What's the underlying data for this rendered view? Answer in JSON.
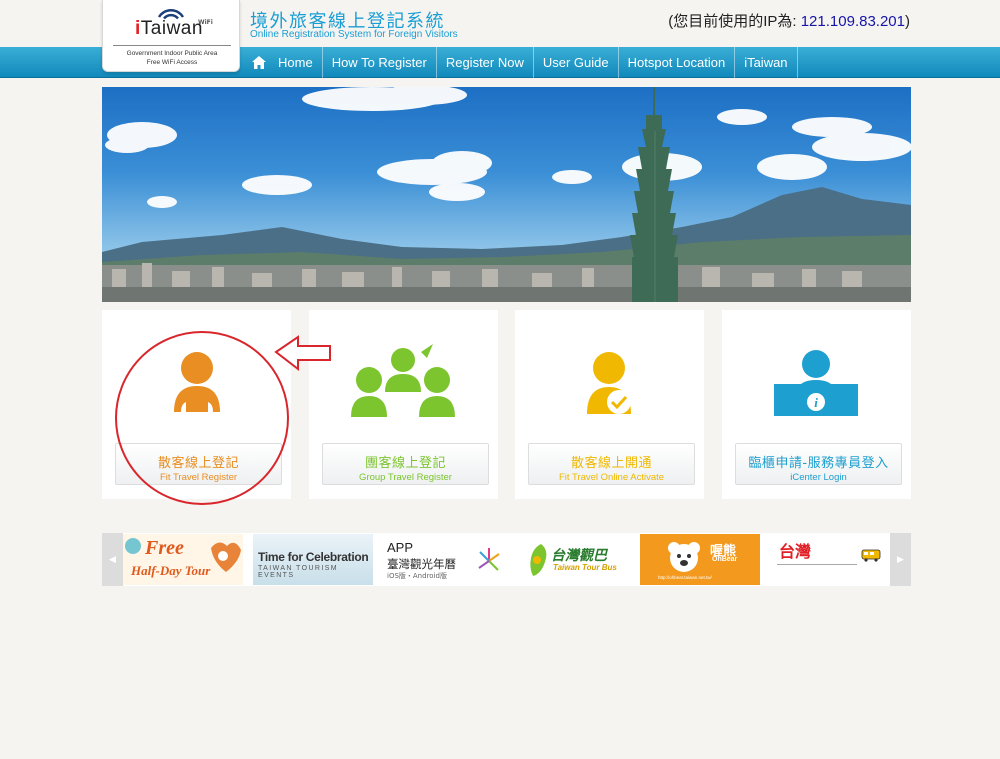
{
  "logo": {
    "brand_prefix": "i",
    "brand_rest": "Taiwan",
    "wifi_label": "WiFi",
    "sub_line1": "Government Indoor Public Area",
    "sub_line2": "Free WiFi Access"
  },
  "header": {
    "title_zh": "境外旅客線上登記系統",
    "title_en": "Online Registration System for Foreign Visitors",
    "ip_prefix": "(您目前使用的IP為: ",
    "ip_value": "121.109.83.201",
    "ip_suffix": ")"
  },
  "nav": {
    "home_icon": "home-icon",
    "items": [
      "Home",
      "How To Register",
      "Register Now",
      "User Guide",
      "Hotspot Location",
      "iTaiwan"
    ]
  },
  "cards": [
    {
      "label_zh": "散客線上登記",
      "label_en": "Fit Travel Register",
      "color": "#e98e22",
      "icon": "single-person-icon"
    },
    {
      "label_zh": "團客線上登記",
      "label_en": "Group Travel Register",
      "color": "#7cc52f",
      "icon": "group-icon"
    },
    {
      "label_zh": "散客線上開通",
      "label_en": "Fit Travel Online Activate",
      "color": "#f0b800",
      "icon": "person-check-icon"
    },
    {
      "label_zh": "臨櫃申請-服務專員登入",
      "label_en": "iCenter  Login",
      "color": "#1d9fd0",
      "icon": "info-counter-icon"
    }
  ],
  "partners": [
    {
      "line1": "Free",
      "line2": "Half-Day Tour"
    },
    {
      "line1": "Time for Celebration",
      "line2": "TAIWAN TOURISM EVENTS"
    },
    {
      "line1": "APP",
      "line2": "臺灣觀光年曆",
      "line3": "iOS版・Android版"
    },
    {
      "line1": "台灣觀巴",
      "line2": "Taiwan Tour Bus"
    },
    {
      "line1": "喔熊",
      "line2": "OhBear",
      "line3": "http://ohbear.taiwan.net.tw/"
    },
    {
      "line1": "台灣"
    }
  ],
  "colors": {
    "accent_blue": "#1a9ed4",
    "nav_blue": "#1189bb",
    "annotation_red": "#d9262c"
  }
}
